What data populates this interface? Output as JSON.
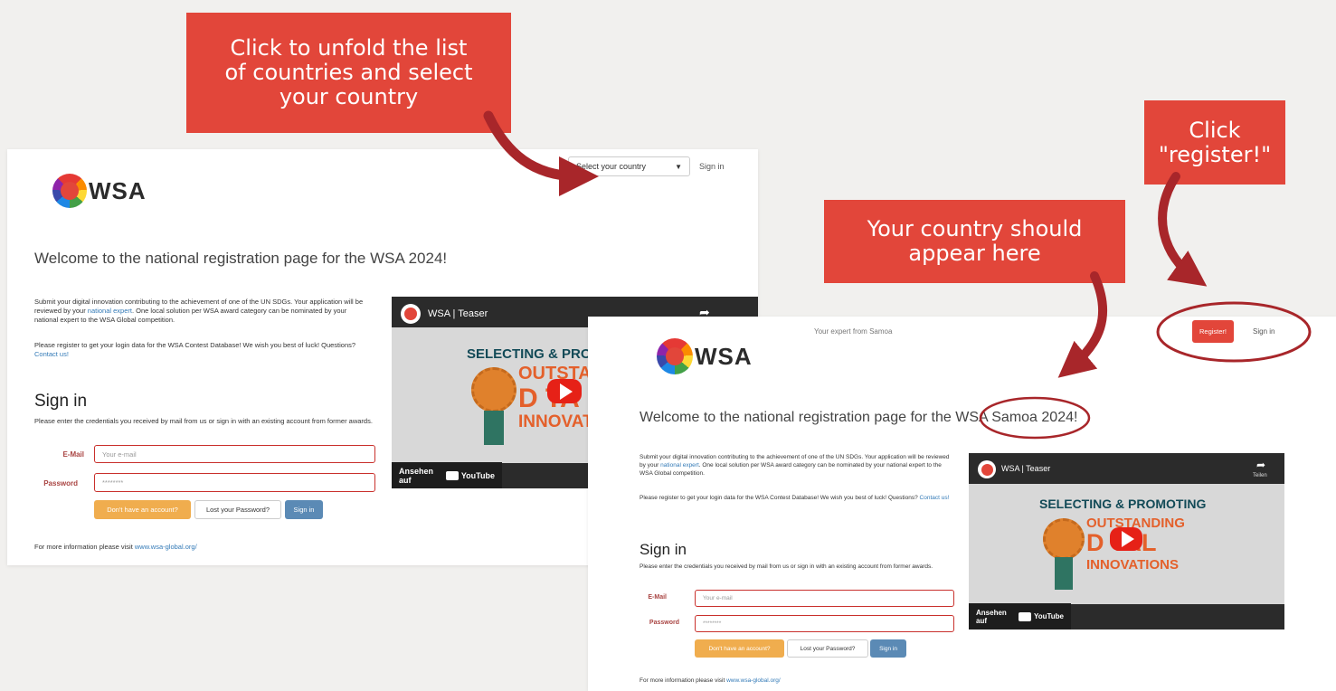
{
  "callouts": {
    "unfold": "Click to unfold the list\nof countries and select\nyour country",
    "register": "Click\n\"register!\"",
    "country_here": "Your country should\nappear here"
  },
  "colors": {
    "callout_red": "#e2463a",
    "arrow_dark_red": "#a8262a",
    "link_blue": "#337ab7",
    "button_orange": "#f0ad4e",
    "button_blue": "#5b8ab5"
  },
  "left_page": {
    "logo": "WSA",
    "country_select": {
      "value": "Select your country",
      "arrow_icon": "caret-down-icon"
    },
    "signin_link": "Sign in",
    "welcome": "Welcome to the national registration page for the WSA 2024!",
    "para1_a": "Submit your digital innovation contributing to the achievement of one of the UN SDGs. Your application will be reviewed by your ",
    "para1_link": "national expert",
    "para1_b": ". One local solution per WSA award category can be nominated by your national expert to the WSA Global competition.",
    "para2_a": "Please register to get your login data for the WSA Contest Database! We wish you best of luck! Questions? ",
    "para2_link": "Contact us!",
    "signin_heading": "Sign in",
    "signin_desc": "Please enter the credentials you received by mail from us or sign in with an existing account from former awards.",
    "email_label": "E-Mail",
    "email_placeholder": "Your e-mail",
    "password_label": "Password",
    "password_placeholder": "********",
    "btn_no_account": "Don't have an account?",
    "btn_lost_password": "Lost your Password?",
    "btn_signin": "Sign in",
    "footer_a": "For more information please visit ",
    "footer_link": "www.wsa-global.org/",
    "video": {
      "title": "WSA | Teaser",
      "line1": "SELECTING & PROMO",
      "line2": "OUTSTAN",
      "line3": "D   TA",
      "line4": "INNOVAT",
      "watch": "Ansehen auf",
      "yt": "YouTube"
    }
  },
  "right_page": {
    "logo": "WSA",
    "expert_text": "Your expert from Samoa",
    "register_btn": "Register!",
    "signin_link": "Sign in",
    "welcome_a": "Welcome to the national registration page for the WS",
    "welcome_b": "A Samoa 2024!",
    "para1_a": "Submit your digital innovation contributing to the achievement of one of the UN SDGs. Your application will be reviewed by your ",
    "para1_link": "national expert",
    "para1_b": ". One local solution per WSA award category can be nominated by your national expert to the WSA Global competition.",
    "para2_a": "Please register to get your login data for the WSA Contest Database! We wish you best of luck! Questions? ",
    "para2_link": "Contact us!",
    "signin_heading": "Sign in",
    "signin_desc": "Please enter the credentials you received by mail from us or sign in with an existing account from former awards.",
    "email_label": "E-Mail",
    "email_placeholder": "Your e-mail",
    "password_label": "Password",
    "password_placeholder": "********",
    "btn_no_account": "Don't have an account?",
    "btn_lost_password": "Lost your Password?",
    "btn_signin": "Sign in",
    "footer_a": "For more information please visit ",
    "footer_link": "www.wsa-global.org/",
    "video": {
      "title": "WSA | Teaser",
      "share": "Teilen",
      "line1": "SELECTING & PROMOTING",
      "line2": "OUTSTANDING",
      "line3": "D   TAL",
      "line4": "INNOVATIONS",
      "watch": "Ansehen auf",
      "yt": "YouTube"
    }
  }
}
